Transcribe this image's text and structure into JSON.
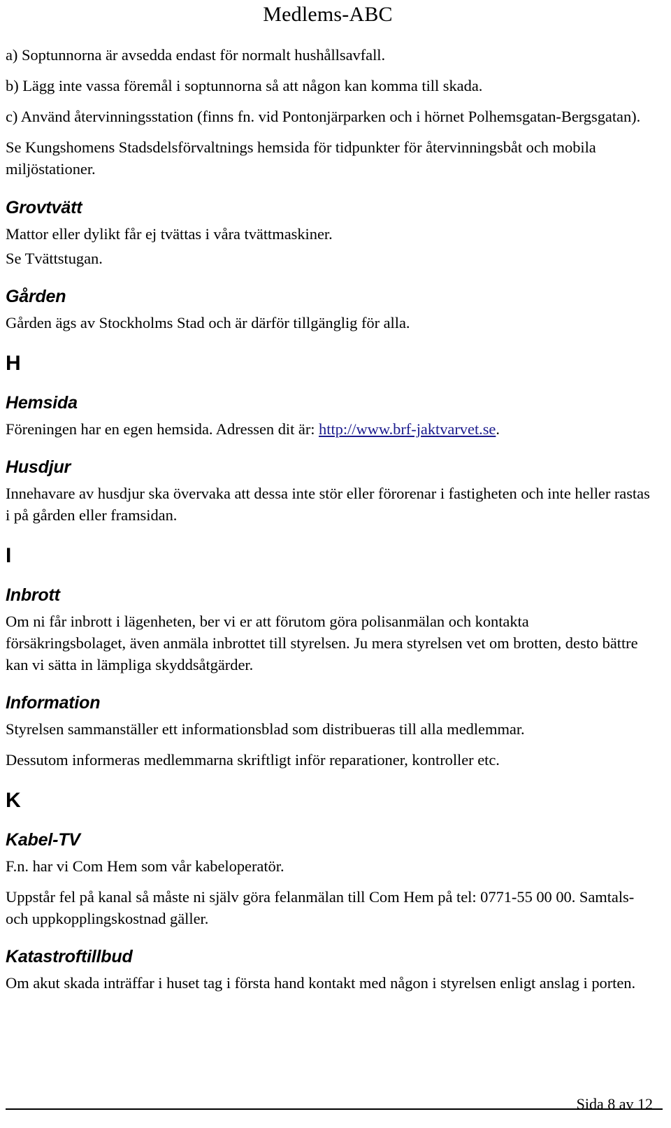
{
  "document": {
    "title": "Medlems-ABC",
    "language": "sv",
    "link_color": "#1a1a8c",
    "text_color": "#000000",
    "background_color": "#ffffff"
  },
  "intro_list": {
    "item_a": "a) Soptunnorna är avsedda endast för normalt hushållsavfall.",
    "item_b": "b) Lägg inte vassa föremål i soptunnorna så att någon kan komma till skada.",
    "item_c": "c) Använd återvinningsstation (finns fn. vid Pontonjärparken och i hörnet Polhemsgatan-Bergsgatan).",
    "item_d": "Se Kungshomens Stadsdelsförvaltnings hemsida för tidpunkter för återvinningsbåt och mobila miljöstationer."
  },
  "sections": {
    "grovtvatt": {
      "heading": "Grovtvätt",
      "para1": "Mattor eller dylikt får ej tvättas i våra tvättmaskiner.",
      "para2": "Se Tvättstugan."
    },
    "garden": {
      "heading": "Gården",
      "para1": "Gården ägs av Stockholms Stad och är därför tillgänglig för alla."
    },
    "letter_h": "H",
    "hemsida": {
      "heading": "Hemsida",
      "para_prefix": "Föreningen har en egen hemsida. Adressen dit är: ",
      "link_text": "http://www.brf-jaktvarvet.se",
      "para_suffix": "."
    },
    "husdjur": {
      "heading": "Husdjur",
      "para1": "Innehavare av husdjur ska övervaka att dessa inte stör eller förorenar i fastigheten och inte heller rastas i på gården eller framsidan."
    },
    "letter_i": "I",
    "inbrott": {
      "heading": "Inbrott",
      "para1": "Om ni får inbrott i lägenheten, ber vi er att förutom göra polisanmälan och kontakta försäkringsbolaget, även anmäla inbrottet till styrelsen. Ju mera styrelsen vet om brotten, desto bättre kan vi sätta in lämpliga skyddsåtgärder."
    },
    "information": {
      "heading": "Information",
      "para1": "Styrelsen sammanställer ett informationsblad som distribueras till alla medlemmar.",
      "para2": "Dessutom informeras medlemmarna skriftligt inför reparationer, kontroller etc."
    },
    "letter_k": "K",
    "kabel_tv": {
      "heading": "Kabel-TV",
      "para1": "F.n. har vi Com Hem som vår kabeloperatör.",
      "para2": "Uppstår fel på kanal så måste ni själv göra felanmälan till Com Hem på tel: 0771-55 00 00. Samtals- och uppkopplingskostnad gäller."
    },
    "katastroftillbud": {
      "heading": "Katastroftillbud",
      "para1": "Om akut skada inträffar i huset tag i första hand kontakt med någon i styrelsen enligt anslag i porten."
    }
  },
  "footer": {
    "page_label": "Sida 8 av 12"
  }
}
